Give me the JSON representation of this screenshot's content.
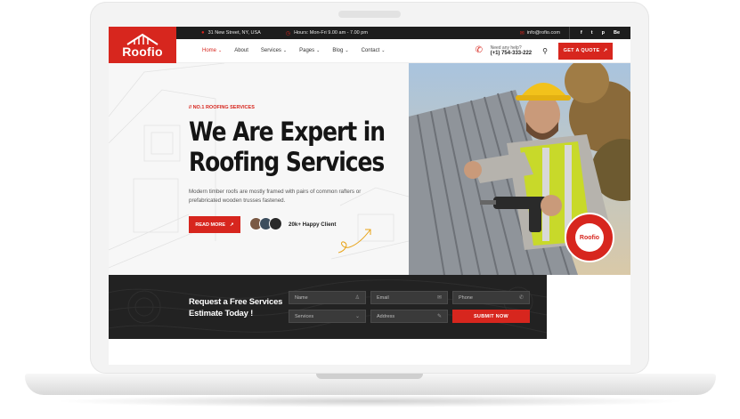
{
  "brand": {
    "name": "Roofio",
    "accent": "#d7261e",
    "dark": "#1d1d1d"
  },
  "topbar": {
    "address": "31 New Street, NY, USA",
    "hours": "Hours: Mon-Fri 9.00 am - 7.00 pm",
    "email": "info@rofio.com",
    "socials": [
      "f",
      "t",
      "p",
      "Be"
    ]
  },
  "nav": {
    "items": [
      {
        "label": "Home",
        "dropdown": true,
        "active": true
      },
      {
        "label": "About",
        "dropdown": false
      },
      {
        "label": "Services",
        "dropdown": true
      },
      {
        "label": "Pages",
        "dropdown": true
      },
      {
        "label": "Blog",
        "dropdown": true
      },
      {
        "label": "Contact",
        "dropdown": true
      }
    ],
    "help_label": "Need any help?",
    "help_number": "(+1) 754-333-222",
    "quote_label": "GET A QUOTE"
  },
  "hero": {
    "eyebrow": "// NO.1 ROOFING SERVICES",
    "title_line1": "We Are Expert in",
    "title_line2": "Roofing Services",
    "description": "Modern timber roofs are mostly framed with pairs of common rafters or prefabricated wooden trusses fastened.",
    "read_more": "READ MORE",
    "happy_client": "20k+ Happy Client",
    "badge_name": "Roofio"
  },
  "form": {
    "title_line1": "Request a Free Services",
    "title_line2": "Estimate Today !",
    "name_placeholder": "Name",
    "email_placeholder": "Email",
    "phone_placeholder": "Phone",
    "services_placeholder": "Services",
    "address_placeholder": "Address",
    "submit_label": "SUBMIT NOW"
  }
}
